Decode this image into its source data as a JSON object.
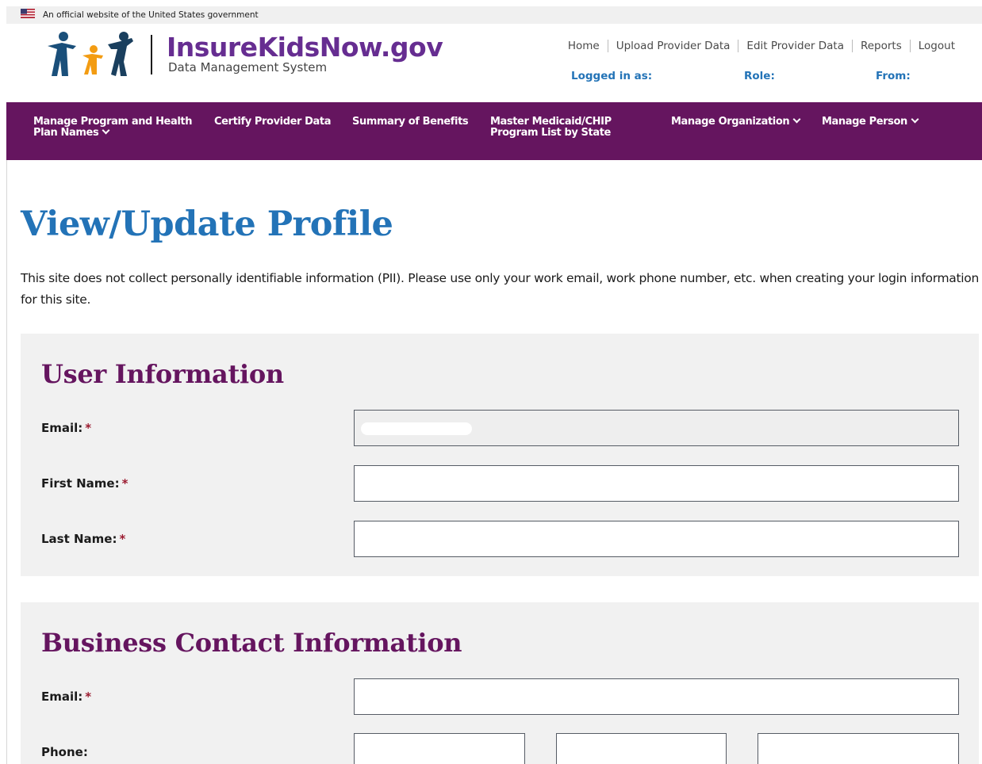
{
  "gov_banner": {
    "text": "An official website of the United States government"
  },
  "header": {
    "logo_title": "InsureKidsNow.gov",
    "logo_subtitle": "Data Management System",
    "utility_nav": [
      "Home",
      "Upload Provider Data",
      "Edit Provider Data",
      "Reports",
      "Logout"
    ],
    "logged_in_label": "Logged in as:",
    "role_label": "Role:",
    "from_label": "From:"
  },
  "main_nav": [
    {
      "label": "Manage Program and Health Plan Names",
      "has_dropdown": true
    },
    {
      "label": "Certify Provider Data",
      "has_dropdown": false
    },
    {
      "label": "Summary of Benefits",
      "has_dropdown": false
    },
    {
      "label": "Master Medicaid/CHIP Program List by State",
      "has_dropdown": false
    },
    {
      "label": "Manage Organization",
      "has_dropdown": true
    },
    {
      "label": "Manage Person",
      "has_dropdown": true
    }
  ],
  "page": {
    "title": "View/Update Profile",
    "pii_notice": "This site does not collect personally identifiable information (PII). Please use only your work email, work phone number, etc. when creating your login information for this site."
  },
  "user_info": {
    "heading": "User Information",
    "email_label": "Email:",
    "first_name_label": "First Name:",
    "last_name_label": "Last Name:",
    "required_marker": "*",
    "email_value": "",
    "first_name_value": "",
    "last_name_value": ""
  },
  "business_info": {
    "heading": "Business Contact Information",
    "email_label": "Email:",
    "phone_label": "Phone:",
    "required_marker": "*",
    "email_value": ""
  },
  "colors": {
    "brand_purple": "#65155f",
    "link_blue": "#2373b7",
    "panel_bg": "#f1f1f1",
    "required_red": "#9b1b30"
  }
}
